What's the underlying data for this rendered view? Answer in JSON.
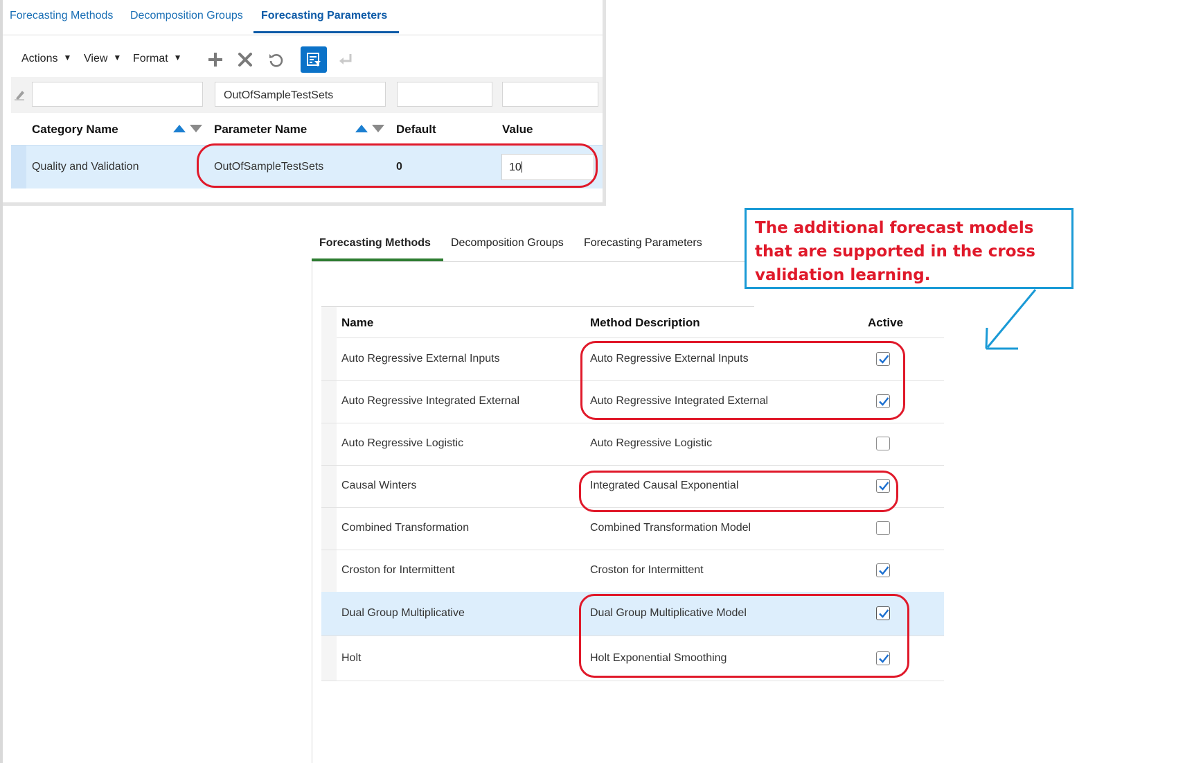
{
  "top": {
    "tabs": [
      "Forecasting Methods",
      "Decomposition Groups",
      "Forecasting Parameters"
    ],
    "active_tab": "Forecasting Parameters",
    "toolbar": {
      "menus": [
        "Actions",
        "View",
        "Format"
      ],
      "icons": [
        "add-icon",
        "delete-icon",
        "refresh-icon",
        "query-by-example-icon",
        "return-icon"
      ]
    },
    "filters": {
      "category": "",
      "parameter": "OutOfSampleTestSets",
      "default": "",
      "value": ""
    },
    "columns": [
      "Category Name",
      "Parameter Name",
      "Default",
      "Value"
    ],
    "row": {
      "category": "Quality and Validation",
      "parameter": "OutOfSampleTestSets",
      "default": "0",
      "value": "10"
    }
  },
  "bottom": {
    "tabs": [
      "Forecasting Methods",
      "Decomposition Groups",
      "Forecasting Parameters"
    ],
    "active_tab": "Forecasting Methods",
    "columns": [
      "Name",
      "Method Description",
      "Active"
    ],
    "rows": [
      {
        "name": "Auto Regressive External Inputs",
        "description": "Auto Regressive External Inputs",
        "active": true
      },
      {
        "name": "Auto Regressive Integrated External",
        "description": "Auto Regressive Integrated External",
        "active": true
      },
      {
        "name": "Auto Regressive Logistic",
        "description": "Auto Regressive Logistic",
        "active": false
      },
      {
        "name": "Causal Winters",
        "description": "Integrated Causal Exponential",
        "active": true
      },
      {
        "name": "Combined Transformation",
        "description": "Combined Transformation Model",
        "active": false
      },
      {
        "name": "Croston for Intermittent",
        "description": "Croston for Intermittent",
        "active": true
      },
      {
        "name": "Dual Group Multiplicative",
        "description": "Dual Group Multiplicative Model",
        "active": true
      },
      {
        "name": "Holt",
        "description": "Holt Exponential Smoothing",
        "active": true
      }
    ]
  },
  "annotation": {
    "callout_text": "The additional forecast models that are supported in the cross validation learning.",
    "colors": {
      "highlight_ring": "#e0192a",
      "callout_border": "#1a9ad6",
      "callout_text": "#e0192a"
    }
  }
}
